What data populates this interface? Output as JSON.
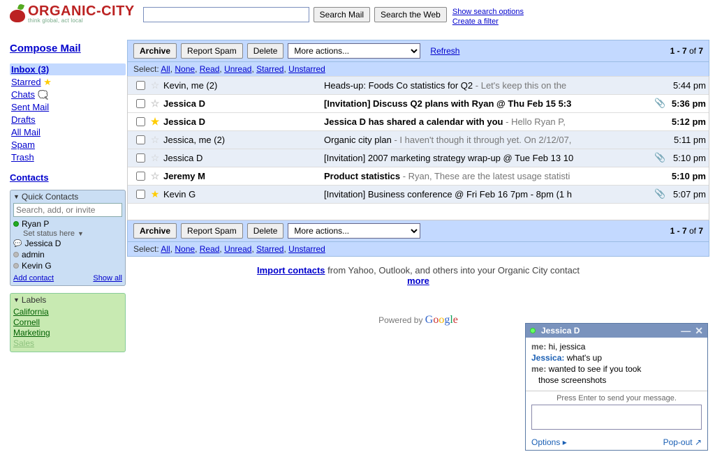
{
  "brand": {
    "name": "ORGANIC-CITY",
    "tagline": "think global, act local"
  },
  "search": {
    "value": "",
    "btn_mail": "Search Mail",
    "btn_web": "Search the Web",
    "opt_link": "Show search options",
    "filter_link": "Create a filter"
  },
  "nav": {
    "compose": "Compose Mail",
    "items": [
      {
        "label": "Inbox (3)"
      },
      {
        "label": "Starred"
      },
      {
        "label": "Chats"
      },
      {
        "label": "Sent Mail"
      },
      {
        "label": "Drafts"
      },
      {
        "label": "All Mail"
      },
      {
        "label": "Spam"
      },
      {
        "label": "Trash"
      }
    ],
    "contacts": "Contacts"
  },
  "quick_contacts": {
    "title": "Quick Contacts",
    "search_placeholder": "Search, add, or invite",
    "me": "Ryan P",
    "status_hint": "Set status here",
    "contacts": [
      {
        "name": "Jessica D",
        "state": "chat"
      },
      {
        "name": "admin",
        "state": "offline"
      },
      {
        "name": "Kevin G",
        "state": "offline"
      }
    ],
    "add": "Add contact",
    "show_all": "Show all"
  },
  "labels": {
    "title": "Labels",
    "items": [
      "California",
      "Cornell",
      "Marketing",
      "Sales"
    ]
  },
  "toolbar": {
    "archive": "Archive",
    "spam": "Report Spam",
    "delete": "Delete",
    "more": "More actions...",
    "refresh": "Refresh",
    "pager_range": "1 - 7",
    "pager_of": " of ",
    "pager_total": "7"
  },
  "select_bar": {
    "prefix": "Select:",
    "links": [
      "All",
      "None",
      "Read",
      "Unread",
      "Starred",
      "Unstarred"
    ]
  },
  "emails": [
    {
      "read": true,
      "starred": false,
      "sender": "Kevin, me (2)",
      "subject": "Heads-up: Foods Co statistics for Q2",
      "snippet": " - Let's keep this on the",
      "attach": false,
      "time": "5:44 pm"
    },
    {
      "read": false,
      "starred": false,
      "sender": "Jessica D",
      "subject": "[Invitation] Discuss Q2 plans with Ryan @ Thu Feb 15 5:3",
      "snippet": "",
      "attach": true,
      "time": "5:36 pm"
    },
    {
      "read": false,
      "starred": true,
      "sender": "Jessica D",
      "subject": "Jessica D has shared a calendar with you",
      "snippet": " - Hello Ryan P,",
      "attach": false,
      "time": "5:12 pm"
    },
    {
      "read": true,
      "starred": false,
      "sender": "Jessica, me (2)",
      "subject": "Organic city plan",
      "snippet": " - I haven't though it through yet. On 2/12/07,",
      "attach": false,
      "time": "5:11 pm"
    },
    {
      "read": true,
      "starred": false,
      "sender": "Jessica D",
      "subject": "[Invitation] 2007 marketing strategy wrap-up @ Tue Feb 13 10",
      "snippet": "",
      "attach": true,
      "time": "5:10 pm"
    },
    {
      "read": false,
      "starred": false,
      "sender": "Jeremy M",
      "subject": "Product statistics",
      "snippet": " - Ryan, These are the latest usage statisti",
      "attach": false,
      "time": "5:10 pm"
    },
    {
      "read": true,
      "starred": true,
      "sender": "Kevin G",
      "subject": "[Invitation] Business conference @ Fri Feb 16 7pm - 8pm (1 h",
      "snippet": "",
      "attach": true,
      "time": "5:07 pm"
    }
  ],
  "import_line": {
    "link": "Import contacts",
    "rest": " from Yahoo, Outlook, and others into your Organic City contact",
    "more": "more"
  },
  "powered": {
    "prefix": "Powered by "
  },
  "chat": {
    "peer": "Jessica D",
    "lines": [
      {
        "who": "me",
        "text": "hi, jessica"
      },
      {
        "who": "Jessica",
        "text": "what's up"
      },
      {
        "who": "me",
        "text": "wanted to see if you took"
      },
      {
        "who": "",
        "text": "those screenshots"
      }
    ],
    "hint": "Press Enter to send your message.",
    "options": "Options",
    "popout": "Pop-out"
  }
}
